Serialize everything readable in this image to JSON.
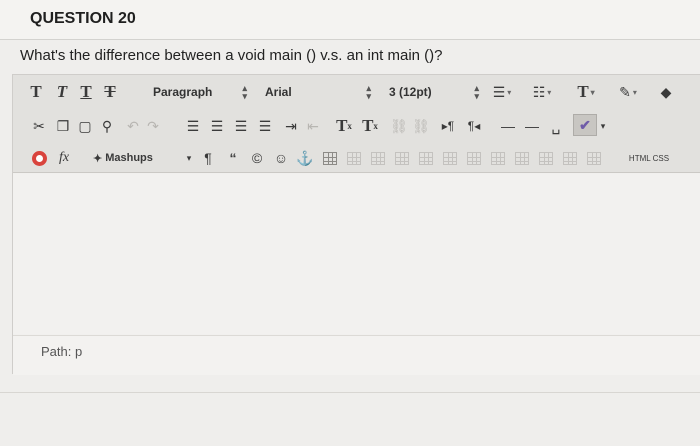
{
  "question": {
    "number_label": "QUESTION 20",
    "text": "What's the difference between a void main () v.s.  an int  main  ()?"
  },
  "toolbar": {
    "row1": {
      "text_buttons": [
        "T",
        "T",
        "T",
        "T"
      ],
      "paragraph_select": "Paragraph",
      "font_select": "Arial",
      "size_select": "3 (12pt)",
      "text_color_label": "T"
    },
    "row2": {
      "superscript_label": "T",
      "subscript_label": "T",
      "sup_mark": "x",
      "sub_mark": "x"
    },
    "row3": {
      "fx_label": "fx",
      "mashups_label": "Mashups",
      "pilcrow": "¶",
      "quote": "“",
      "copyright": "©",
      "html_css_label": "HTML CSS"
    }
  },
  "path": {
    "label": "Path: p"
  },
  "colors": {
    "accent_red": "#d9443d",
    "spellcheck_purple": "#6f5ca8"
  }
}
